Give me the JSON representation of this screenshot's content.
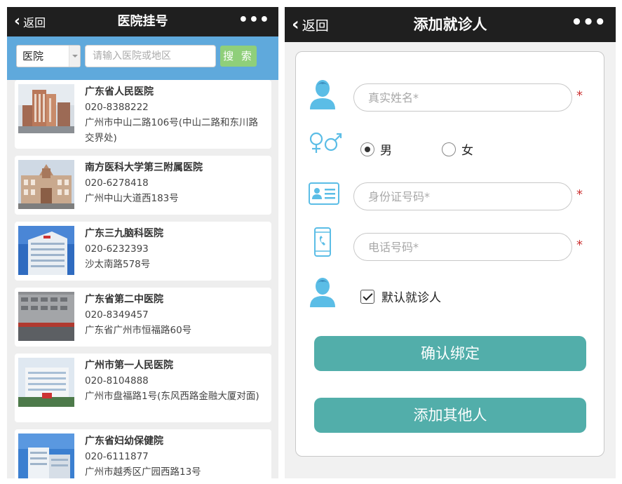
{
  "left": {
    "nav": {
      "back": "返回",
      "title": "医院挂号",
      "more": "•••"
    },
    "search": {
      "select_value": "医院",
      "placeholder": "请输入医院或地区",
      "button": "搜 索"
    },
    "hospitals": [
      {
        "name": "广东省人民医院",
        "phone": "020-8388222",
        "address": "广州市中山二路106号(中山二路和东川路交界处)"
      },
      {
        "name": "南方医科大学第三附属医院",
        "phone": "020-6278418",
        "address": "广州中山大道西183号"
      },
      {
        "name": "广东三九脑科医院",
        "phone": "020-6232393",
        "address": "沙太南路578号"
      },
      {
        "name": "广东省第二中医院",
        "phone": "020-8349457",
        "address": "广东省广州市恒福路60号"
      },
      {
        "name": "广州市第一人民医院",
        "phone": "020-8104888",
        "address": "广州市盘福路1号(东风西路金融大厦对面)"
      },
      {
        "name": "广东省妇幼保健院",
        "phone": "020-6111877",
        "address": "广州市越秀区广园西路13号"
      }
    ]
  },
  "right": {
    "nav": {
      "back": "返回",
      "title": "添加就诊人",
      "more": "•••"
    },
    "form": {
      "name_placeholder": "真实姓名*",
      "gender_male": "男",
      "gender_female": "女",
      "gender_selected": "男",
      "id_placeholder": "身份证号码*",
      "phone_placeholder": "电话号码*",
      "required_mark": "*",
      "default_patient": "默认就诊人",
      "default_checked": true,
      "confirm_button": "确认绑定",
      "add_other_button": "添加其他人"
    },
    "colors": {
      "accent": "#52aeaa",
      "icon": "#5bbde6",
      "required": "#cc3333"
    }
  }
}
